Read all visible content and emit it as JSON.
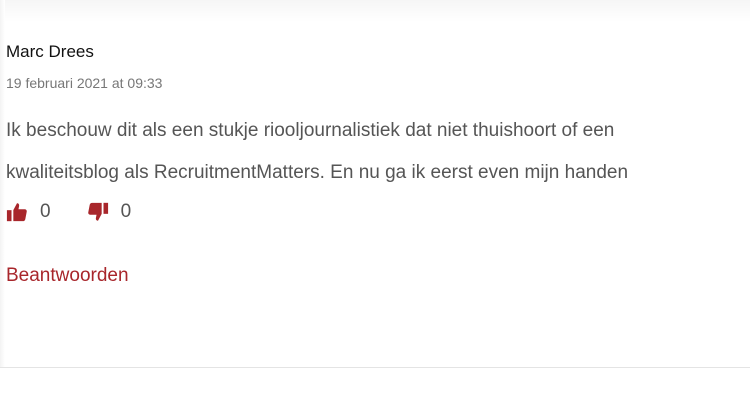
{
  "comment": {
    "author": "Marc Drees",
    "date": "19 februari 2021 at 09:33",
    "body_lines": [
      "Ik beschouw dit als een stukje riooljournalistiek dat niet thuishoort of een",
      "kwaliteitsblog als RecruitmentMatters. En nu ga ik eerst even mijn handen"
    ],
    "likes": "0",
    "dislikes": "0",
    "reply_label": "Beantwoorden"
  },
  "icons": {
    "like": "thumbs-up-icon",
    "dislike": "thumbs-down-icon"
  },
  "colors": {
    "accent": "#a8262b",
    "text": "#555555",
    "author": "#111111",
    "meta": "#777777"
  }
}
